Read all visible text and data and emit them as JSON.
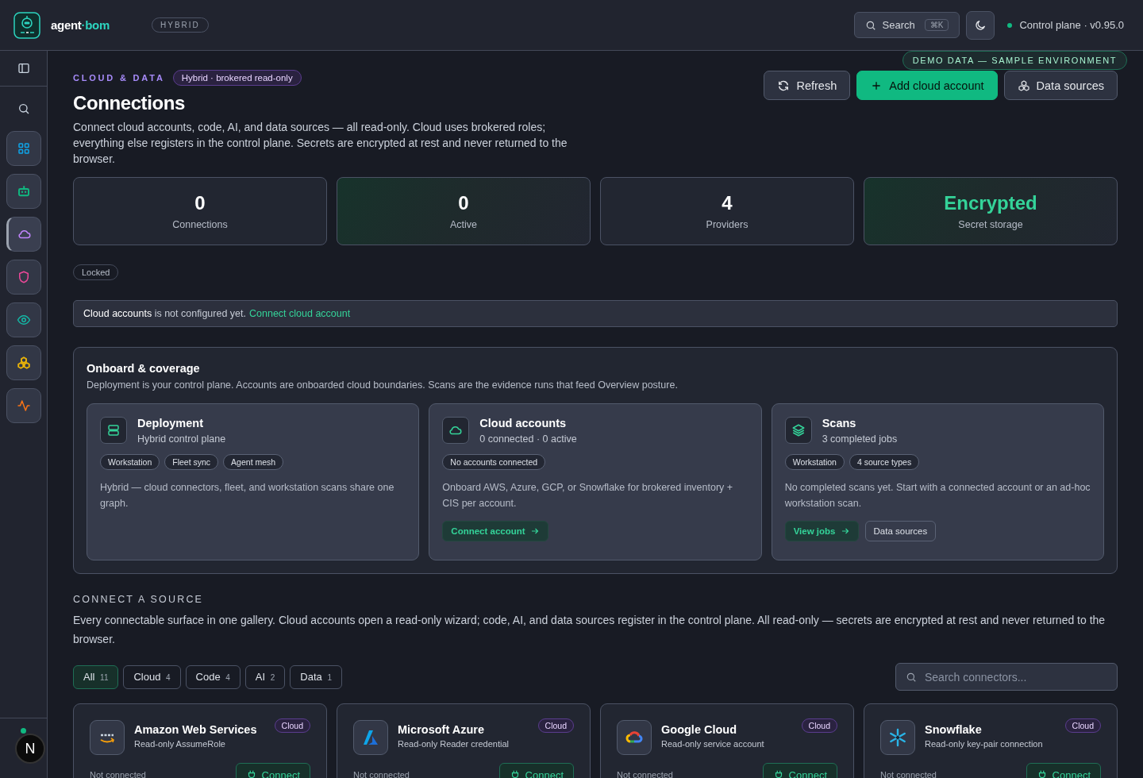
{
  "header": {
    "brand": {
      "name": "agent",
      "accent": "·bom"
    },
    "mode_badge": "HYBRID",
    "search": {
      "label": "Search",
      "shortcut": "⌘K"
    },
    "status": {
      "online": true,
      "label": "Control plane · v0.95.0"
    }
  },
  "demo_banner": "DEMO DATA — SAMPLE ENVIRONMENT",
  "sidebar": {
    "items": [
      {
        "kind": "grid",
        "color": "#0ea5e9",
        "selected": false
      },
      {
        "kind": "bot",
        "color": "#10b981",
        "selected": false
      },
      {
        "kind": "cloud",
        "color": "#c084fc",
        "selected": true
      },
      {
        "kind": "shield",
        "color": "#ec4899",
        "selected": false
      },
      {
        "kind": "eye",
        "color": "#14b8a6",
        "selected": false
      },
      {
        "kind": "cubes",
        "color": "#eab308",
        "selected": false
      },
      {
        "kind": "activity",
        "color": "#f97316",
        "selected": false
      }
    ],
    "dev_badge": "N"
  },
  "page": {
    "eyebrow": "CLOUD & DATA",
    "eyebrow_badge": "Hybrid · brokered read-only",
    "title": "Connections",
    "description": "Connect cloud accounts, code, AI, and data sources — all read-only. Cloud uses brokered roles; everything else registers in the control plane. Secrets are encrypted at rest and never returned to the browser.",
    "actions": [
      {
        "kind": "refresh",
        "label": "Refresh"
      },
      {
        "kind": "primary",
        "label": "Add cloud account"
      },
      {
        "kind": "data",
        "label": "Data sources"
      }
    ]
  },
  "stats": [
    {
      "value": "0",
      "label": "Connections",
      "highlighted": false,
      "accent": false
    },
    {
      "value": "0",
      "label": "Active",
      "highlighted": true,
      "accent": false
    },
    {
      "value": "4",
      "label": "Providers",
      "highlighted": false,
      "accent": false
    },
    {
      "value": "Encrypted",
      "label": "Secret storage",
      "highlighted": true,
      "accent": true
    }
  ],
  "lock_badge": "Locked",
  "alert": {
    "text": "**Cloud accounts** is not configured yet.",
    "link": "Connect cloud account"
  },
  "onboard": {
    "title": "Onboard & coverage",
    "description": "Deployment is your control plane. Accounts are onboarded cloud boundaries. Scans are the evidence runs that feed Overview posture.",
    "cards": [
      {
        "kind": "server",
        "title": "Deployment",
        "subtitle": "Hybrid control plane",
        "tags": [
          "Workstation",
          "Fleet sync",
          "Agent mesh"
        ],
        "body": "Hybrid — cloud connectors, fleet, and workstation scans share one graph."
      },
      {
        "kind": "cloud",
        "title": "Cloud accounts",
        "subtitle": "0 connected · 0 active",
        "tags": [
          "No accounts connected"
        ],
        "body": "Onboard AWS, Azure, GCP, or Snowflake for brokered inventory + CIS per account.",
        "actions": [
          {
            "kind": "primary",
            "label": "Connect account"
          }
        ]
      },
      {
        "kind": "layers",
        "title": "Scans",
        "subtitle": "3 completed jobs",
        "tags": [
          "Workstation",
          "4 source types"
        ],
        "body": "No completed scans yet. Start with a connected account or an ad-hoc workstation scan.",
        "actions": [
          {
            "kind": "primary",
            "label": "View jobs"
          },
          {
            "kind": "secondary",
            "label": "Data sources"
          }
        ]
      }
    ]
  },
  "gallery": {
    "heading": "CONNECT A SOURCE",
    "description": "Every connectable surface in one gallery. Cloud accounts open a read-only wizard; code, AI, and data sources register in the control plane. All read-only — secrets are encrypted at rest and never returned to the browser.",
    "filters": [
      {
        "label": "All",
        "count": "11",
        "selected": true
      },
      {
        "label": "Cloud",
        "count": "4",
        "selected": false
      },
      {
        "label": "Code",
        "count": "4",
        "selected": false
      },
      {
        "label": "AI",
        "count": "2",
        "selected": false
      },
      {
        "label": "Data",
        "count": "1",
        "selected": false
      }
    ],
    "search": {
      "placeholder": "Search connectors..."
    },
    "connectors": [
      {
        "kind": "aws",
        "name": "Amazon Web Services",
        "subtitle": "Read-only AssumeRole",
        "tag": "Cloud",
        "status": "Not connected",
        "action": "Connect"
      },
      {
        "kind": "azure",
        "name": "Microsoft Azure",
        "subtitle": "Read-only Reader credential",
        "tag": "Cloud",
        "status": "Not connected",
        "action": "Connect"
      },
      {
        "kind": "gcp",
        "name": "Google Cloud",
        "subtitle": "Read-only service account",
        "tag": "Cloud",
        "status": "Not connected",
        "action": "Connect"
      },
      {
        "kind": "snowflake",
        "name": "Snowflake",
        "subtitle": "Read-only key-pair connection",
        "tag": "Cloud",
        "status": "Not connected",
        "action": "Connect"
      }
    ]
  }
}
